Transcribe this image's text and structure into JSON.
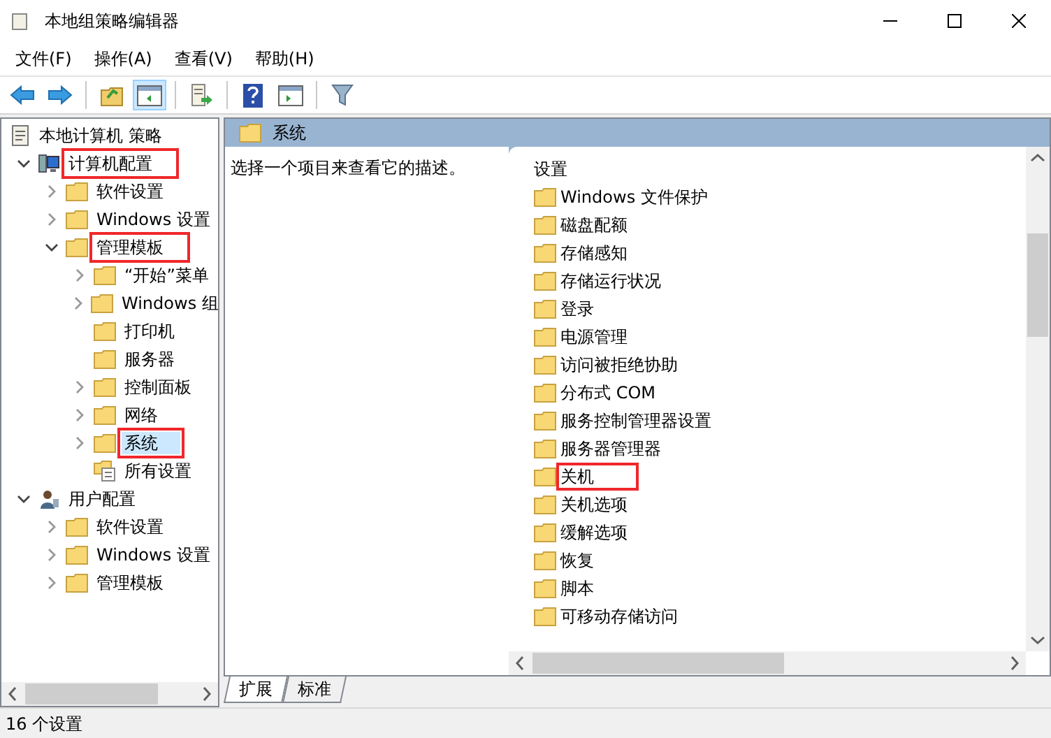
{
  "window": {
    "title": "本地组策略编辑器"
  },
  "menu": [
    "文件(F)",
    "操作(A)",
    "查看(V)",
    "帮助(H)"
  ],
  "toolbar": [
    {
      "kind": "back",
      "pressed": false
    },
    {
      "kind": "forward",
      "pressed": false
    },
    {
      "kind": "separator"
    },
    {
      "kind": "up",
      "pressed": false
    },
    {
      "kind": "tree",
      "pressed": true
    },
    {
      "kind": "separator"
    },
    {
      "kind": "export",
      "pressed": false
    },
    {
      "kind": "separator"
    },
    {
      "kind": "help",
      "pressed": false
    },
    {
      "kind": "pane",
      "pressed": false
    },
    {
      "kind": "separator"
    },
    {
      "kind": "filter",
      "pressed": false
    }
  ],
  "tree": {
    "label": "本地计算机 策略",
    "kind": "policy",
    "selected": false,
    "highlighted": false,
    "children": [
      {
        "label": "计算机配置",
        "kind": "computer",
        "expanded": true,
        "selected": false,
        "highlighted": true,
        "children": [
          {
            "label": "软件设置",
            "kind": "folder",
            "expanded": false,
            "selected": false,
            "highlighted": false
          },
          {
            "label": "Windows 设置",
            "kind": "folder",
            "expanded": false,
            "selected": false,
            "highlighted": false
          },
          {
            "label": "管理模板",
            "kind": "folder",
            "expanded": true,
            "selected": false,
            "highlighted": true,
            "children": [
              {
                "label": "“开始”菜单",
                "kind": "folder",
                "expanded": false,
                "selected": false,
                "highlighted": false
              },
              {
                "label": "Windows 组",
                "kind": "folder",
                "expanded": false,
                "selected": false,
                "highlighted": false
              },
              {
                "label": "打印机",
                "kind": "folder",
                "selected": false,
                "highlighted": false
              },
              {
                "label": "服务器",
                "kind": "folder",
                "selected": false,
                "highlighted": false
              },
              {
                "label": "控制面板",
                "kind": "folder",
                "expanded": false,
                "selected": false,
                "highlighted": false
              },
              {
                "label": "网络",
                "kind": "folder",
                "expanded": false,
                "selected": false,
                "highlighted": false
              },
              {
                "label": "系统",
                "kind": "folder",
                "expanded": false,
                "selected": true,
                "highlighted": true
              },
              {
                "label": "所有设置",
                "kind": "settings",
                "selected": false,
                "highlighted": false
              }
            ]
          }
        ]
      },
      {
        "label": "用户配置",
        "kind": "user",
        "expanded": true,
        "selected": false,
        "highlighted": false,
        "children": [
          {
            "label": "软件设置",
            "kind": "folder",
            "expanded": false,
            "selected": false,
            "highlighted": false
          },
          {
            "label": "Windows 设置",
            "kind": "folder",
            "expanded": false,
            "selected": false,
            "highlighted": false
          },
          {
            "label": "管理模板",
            "kind": "folder",
            "expanded": false,
            "selected": false,
            "highlighted": false
          }
        ]
      }
    ]
  },
  "header": {
    "title": "系统"
  },
  "description": "选择一个项目来查看它的描述。",
  "list": {
    "column": "设置",
    "items": [
      {
        "label": "Windows 文件保护",
        "highlighted": false
      },
      {
        "label": "磁盘配额",
        "highlighted": false
      },
      {
        "label": "存储感知",
        "highlighted": false
      },
      {
        "label": "存储运行状况",
        "highlighted": false
      },
      {
        "label": "登录",
        "highlighted": false
      },
      {
        "label": "电源管理",
        "highlighted": false
      },
      {
        "label": "访问被拒绝协助",
        "highlighted": false
      },
      {
        "label": "分布式 COM",
        "highlighted": false
      },
      {
        "label": "服务控制管理器设置",
        "highlighted": false
      },
      {
        "label": "服务器管理器",
        "highlighted": false
      },
      {
        "label": "关机",
        "highlighted": true
      },
      {
        "label": "关机选项",
        "highlighted": false
      },
      {
        "label": "缓解选项",
        "highlighted": false
      },
      {
        "label": "恢复",
        "highlighted": false
      },
      {
        "label": "脚本",
        "highlighted": false
      },
      {
        "label": "可移动存储访问",
        "highlighted": false
      }
    ]
  },
  "tabs": [
    {
      "label": "扩展",
      "selected": true
    },
    {
      "label": "标准",
      "selected": false
    }
  ],
  "status_bar": {
    "text": "16 个设置"
  }
}
